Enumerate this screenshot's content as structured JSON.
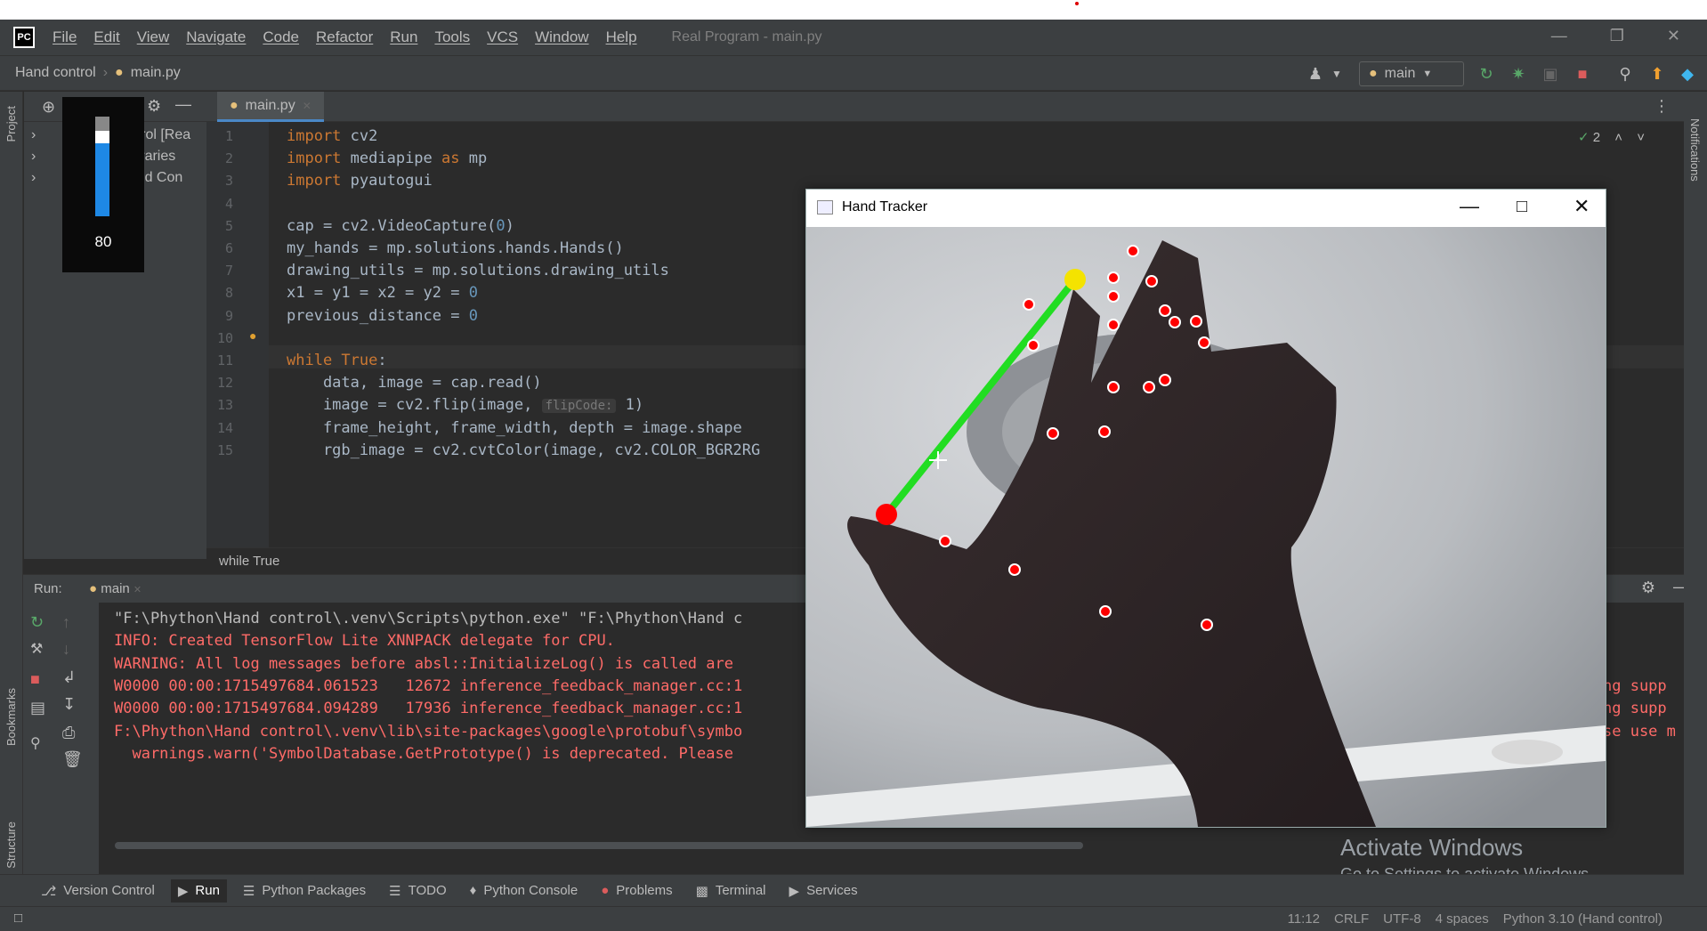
{
  "menu": {
    "logo": "PC",
    "items": [
      "File",
      "Edit",
      "View",
      "Navigate",
      "Code",
      "Refactor",
      "Run",
      "Tools",
      "VCS",
      "Window",
      "Help"
    ],
    "window_title": "Real Program - main.py"
  },
  "nav": {
    "project": "Hand control",
    "file": "main.py",
    "run_config": "main"
  },
  "project_panel": {
    "title": "Project",
    "rows": [
      "ntrol [Rea",
      "ibraries",
      "and Con"
    ]
  },
  "volume_widget": {
    "value": "80",
    "level_percent": 80
  },
  "editor": {
    "tab": "main.py",
    "warnings": "2",
    "lines": [
      {
        "n": "1",
        "parts": [
          [
            "kw",
            "import"
          ],
          [
            "",
            " cv2"
          ]
        ]
      },
      {
        "n": "2",
        "parts": [
          [
            "kw",
            "import"
          ],
          [
            "",
            " mediapipe "
          ],
          [
            "kw",
            "as"
          ],
          [
            "",
            " mp"
          ]
        ]
      },
      {
        "n": "3",
        "parts": [
          [
            "kw",
            "import"
          ],
          [
            "",
            " pyautogui"
          ]
        ]
      },
      {
        "n": "4",
        "parts": []
      },
      {
        "n": "5",
        "parts": [
          [
            "",
            "cap = cv2.VideoCapture("
          ],
          [
            "num",
            "0"
          ],
          [
            "",
            ")"
          ]
        ]
      },
      {
        "n": "6",
        "parts": [
          [
            "",
            "my_hands = mp.solutions.hands.Hands()"
          ]
        ]
      },
      {
        "n": "7",
        "parts": [
          [
            "",
            "drawing_utils = mp.solutions.drawing_utils"
          ]
        ]
      },
      {
        "n": "8",
        "parts": [
          [
            "",
            "x1 = y1 = x2 = y2 = "
          ],
          [
            "num",
            "0"
          ]
        ]
      },
      {
        "n": "9",
        "parts": [
          [
            "",
            "previous_distance = "
          ],
          [
            "num",
            "0"
          ]
        ]
      },
      {
        "n": "10",
        "parts": []
      },
      {
        "n": "11",
        "parts": [
          [
            "kw",
            "while True"
          ],
          [
            "",
            ":"
          ]
        ]
      },
      {
        "n": "12",
        "parts": [
          [
            "",
            "    data, image = cap.read()"
          ]
        ]
      },
      {
        "n": "13",
        "parts": [
          [
            "",
            "    image = cv2.flip(image, "
          ],
          [
            "hint",
            "flipCode:"
          ],
          [
            "",
            " 1)"
          ]
        ]
      },
      {
        "n": "14",
        "parts": [
          [
            "",
            "    frame_height, frame_width, depth = image.shape"
          ]
        ]
      },
      {
        "n": "15",
        "parts": [
          [
            "",
            "    rgb_image = cv2.cvtColor(image, cv2.COLOR_BGR2RG"
          ]
        ]
      }
    ],
    "breadcrumb": "while True"
  },
  "run": {
    "label": "Run:",
    "tab": "main",
    "console": [
      {
        "cls": "path",
        "text": "\"F:\\Phython\\Hand control\\.venv\\Scripts\\python.exe\" \"F:\\Phython\\Hand c"
      },
      {
        "cls": "err",
        "text": "INFO: Created TensorFlow Lite XNNPACK delegate for CPU."
      },
      {
        "cls": "err",
        "text": "WARNING: All log messages before absl::InitializeLog() is called are"
      },
      {
        "cls": "err",
        "text": "W0000 00:00:1715497684.061523   12672 inference_feedback_manager.cc:1"
      },
      {
        "cls": "err",
        "text": "W0000 00:00:1715497684.094289   17936 inference_feedback_manager.cc:1"
      },
      {
        "cls": "err",
        "text": "F:\\Phython\\Hand control\\.venv\\lib\\site-packages\\google\\protobuf\\symbo"
      },
      {
        "cls": "err",
        "text": "  warnings.warn('SymbolDatabase.GetPrototype() is deprecated. Please"
      }
    ],
    "console_right": [
      "ng supp",
      "ng supp",
      "se use m"
    ]
  },
  "tracker": {
    "title": "Hand Tracker",
    "landmarks_label": "hand landmarks"
  },
  "toolwindows": [
    "Version Control",
    "Run",
    "Python Packages",
    "TODO",
    "Python Console",
    "Problems",
    "Terminal",
    "Services"
  ],
  "status": [
    "11:12",
    "CRLF",
    "UTF-8",
    "4 spaces",
    "Python 3.10 (Hand control)"
  ],
  "side_labels": {
    "project": "Project",
    "bookmarks": "Bookmarks",
    "structure": "Structure",
    "notifications": "Notifications"
  },
  "activate": {
    "line1": "Activate Windows",
    "line2": "Go to Settings to activate Windows."
  },
  "colors": {
    "accent": "#4a88c7",
    "error": "#ff6b68",
    "keyword": "#cc7832",
    "number": "#6897bb",
    "line_green": "#22dd22",
    "landmark_red": "#ff0000"
  }
}
